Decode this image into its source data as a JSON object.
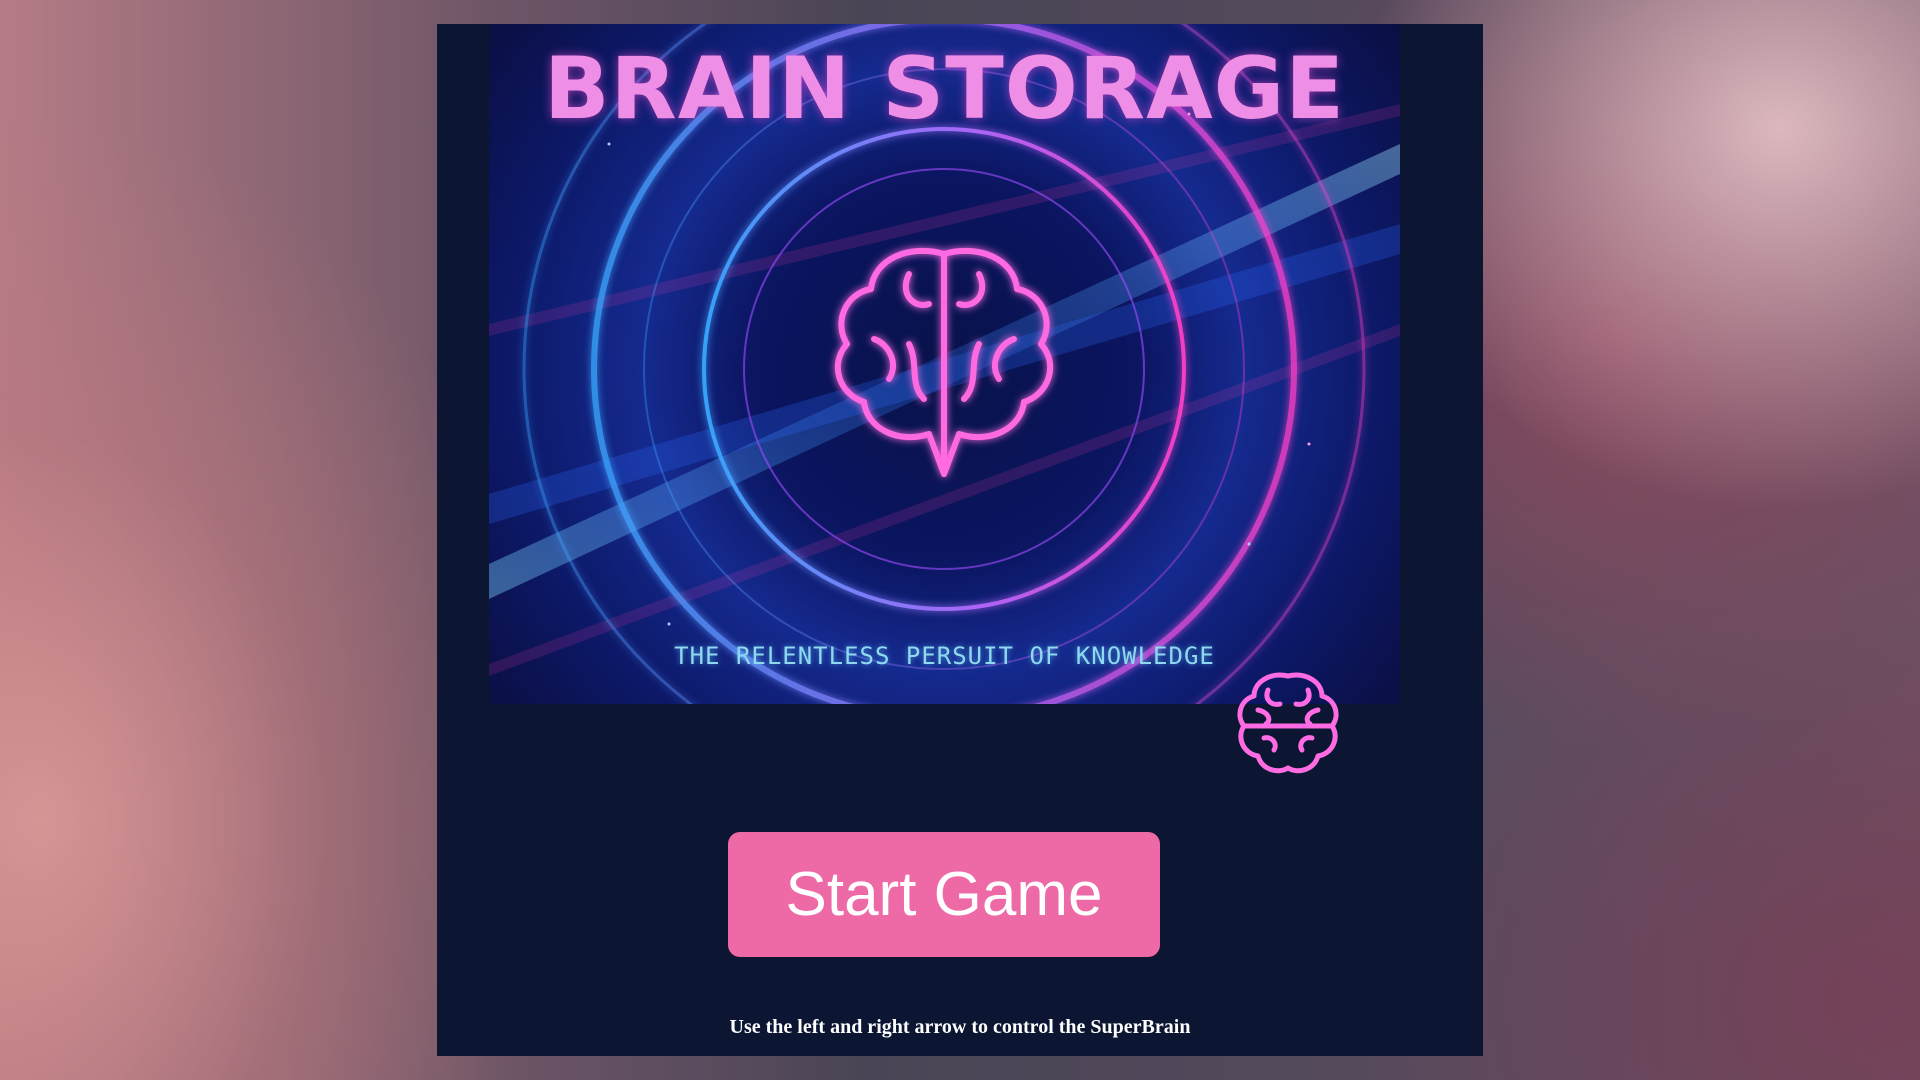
{
  "game": {
    "title": "BRAIN STORAGE",
    "tagline": "THE RELENTLESS PERSUIT OF KNOWLEDGE",
    "start_button_label": "Start Game",
    "instructions": "Use the left and right arrow to control the SuperBrain"
  },
  "icons": {
    "title_brain": "brain-icon",
    "player": "brain-icon"
  },
  "colors": {
    "panel_background": "#0c1632",
    "button_background": "#ee6aa7",
    "title_color": "#ef8ee6",
    "tagline_color": "#8fd8f0",
    "neon_pink": "#ff4fd8",
    "neon_blue": "#3fa6ff"
  }
}
